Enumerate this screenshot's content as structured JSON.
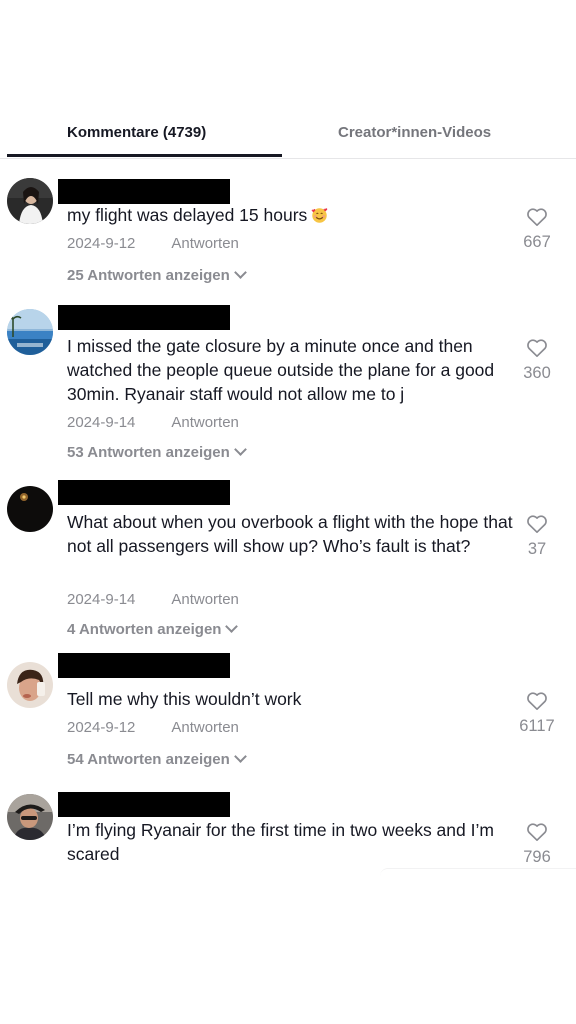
{
  "tabs": {
    "comments_label": "Kommentare (4739)",
    "creator_label": "Creator*innen-Videos"
  },
  "comments": [
    {
      "text": "my flight was delayed 15 hours",
      "emoji": "smiling-face-with-hearts",
      "date": "2024-9-12",
      "reply_label": "Antworten",
      "replies_label": "25 Antworten anzeigen",
      "likes": "667"
    },
    {
      "text": "I missed the gate closure by a minute once and then watched the people queue outside the plane for a good 30min. Ryanair staff would not allow me to j",
      "date": "2024-9-14",
      "reply_label": "Antworten",
      "replies_label": "53 Antworten anzeigen",
      "likes": "360"
    },
    {
      "text": "What about when you overbook a flight with the hope that not all passengers will show up? Who’s fault is that?",
      "date": "2024-9-14",
      "reply_label": "Antworten",
      "replies_label": "4 Antworten anzeigen",
      "likes": "37"
    },
    {
      "text": "Tell me why this wouldn’t work",
      "date": "2024-9-12",
      "reply_label": "Antworten",
      "replies_label": "54 Antworten anzeigen",
      "likes": "6117"
    },
    {
      "text": "I’m flying Ryanair for the first time in two weeks and I’m scared",
      "likes": "796"
    }
  ],
  "colors": {
    "text_primary": "#161823",
    "text_secondary": "#8a8b91",
    "redaction": "#000000"
  }
}
